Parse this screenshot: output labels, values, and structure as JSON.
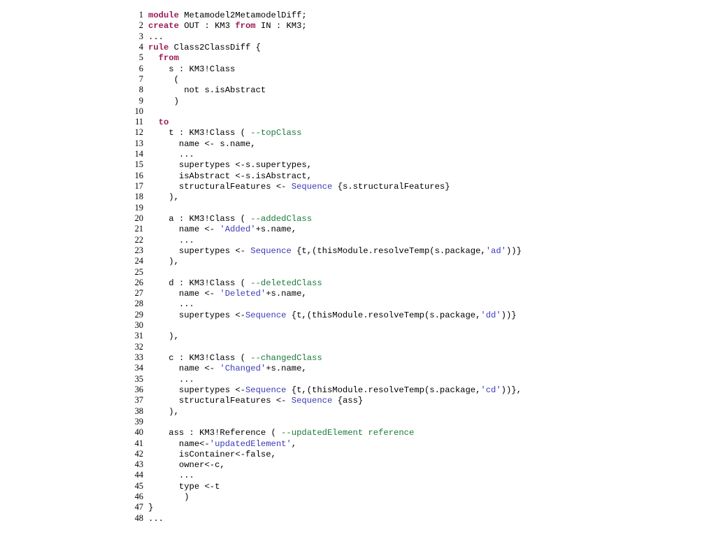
{
  "document": {
    "kind": "source-code-listing",
    "language": "ATL",
    "background_color": "#ffffff",
    "first_line_number": 1,
    "last_line_number": 48
  },
  "colors": {
    "keyword": "#9b1b56",
    "comment": "#1a7a3c",
    "string": "#3a3ab8",
    "type": "#3a3ab8",
    "plain": "#000000",
    "lineno": "#000000",
    "background": "#ffffff"
  },
  "lines": [
    {
      "n": "1",
      "tokens": [
        {
          "t": "kw",
          "v": "module"
        },
        {
          "t": "plain",
          "v": " Metamodel2MetamodelDiff;"
        }
      ]
    },
    {
      "n": "2",
      "tokens": [
        {
          "t": "kw",
          "v": "create"
        },
        {
          "t": "plain",
          "v": " OUT : KM3 "
        },
        {
          "t": "kw",
          "v": "from"
        },
        {
          "t": "plain",
          "v": " IN : KM3;"
        }
      ]
    },
    {
      "n": "3",
      "tokens": [
        {
          "t": "plain",
          "v": "..."
        }
      ]
    },
    {
      "n": "4",
      "tokens": [
        {
          "t": "kw",
          "v": "rule"
        },
        {
          "t": "plain",
          "v": " Class2ClassDiff {"
        }
      ]
    },
    {
      "n": "5",
      "tokens": [
        {
          "t": "plain",
          "v": "  "
        },
        {
          "t": "kw",
          "v": "from"
        }
      ]
    },
    {
      "n": "6",
      "tokens": [
        {
          "t": "plain",
          "v": "    s : KM3!Class"
        }
      ]
    },
    {
      "n": "7",
      "tokens": [
        {
          "t": "plain",
          "v": "     ("
        }
      ]
    },
    {
      "n": "8",
      "tokens": [
        {
          "t": "plain",
          "v": "       not s.isAbstract"
        }
      ]
    },
    {
      "n": "9",
      "tokens": [
        {
          "t": "plain",
          "v": "     )"
        }
      ]
    },
    {
      "n": "10",
      "tokens": [
        {
          "t": "plain",
          "v": ""
        }
      ]
    },
    {
      "n": "11",
      "tokens": [
        {
          "t": "plain",
          "v": "  "
        },
        {
          "t": "kw",
          "v": "to"
        }
      ]
    },
    {
      "n": "12",
      "tokens": [
        {
          "t": "plain",
          "v": "    t : KM3!Class ( "
        },
        {
          "t": "cm",
          "v": "--topClass"
        }
      ]
    },
    {
      "n": "13",
      "tokens": [
        {
          "t": "plain",
          "v": "      name <- s.name,"
        }
      ]
    },
    {
      "n": "14",
      "tokens": [
        {
          "t": "plain",
          "v": "      ..."
        }
      ]
    },
    {
      "n": "15",
      "tokens": [
        {
          "t": "plain",
          "v": "      supertypes <-s.supertypes,"
        }
      ]
    },
    {
      "n": "16",
      "tokens": [
        {
          "t": "plain",
          "v": "      isAbstract <-s.isAbstract,"
        }
      ]
    },
    {
      "n": "17",
      "tokens": [
        {
          "t": "plain",
          "v": "      structuralFeatures <- "
        },
        {
          "t": "type",
          "v": "Sequence"
        },
        {
          "t": "plain",
          "v": " {s.structuralFeatures}"
        }
      ]
    },
    {
      "n": "18",
      "tokens": [
        {
          "t": "plain",
          "v": "    ),"
        }
      ]
    },
    {
      "n": "19",
      "tokens": [
        {
          "t": "plain",
          "v": ""
        }
      ]
    },
    {
      "n": "20",
      "tokens": [
        {
          "t": "plain",
          "v": "    a : KM3!Class ( "
        },
        {
          "t": "cm",
          "v": "--addedClass"
        }
      ]
    },
    {
      "n": "21",
      "tokens": [
        {
          "t": "plain",
          "v": "      name <- "
        },
        {
          "t": "str",
          "v": "'Added'"
        },
        {
          "t": "plain",
          "v": "+s.name,"
        }
      ]
    },
    {
      "n": "22",
      "tokens": [
        {
          "t": "plain",
          "v": "      ..."
        }
      ]
    },
    {
      "n": "23",
      "tokens": [
        {
          "t": "plain",
          "v": "      supertypes <- "
        },
        {
          "t": "type",
          "v": "Sequence"
        },
        {
          "t": "plain",
          "v": " {t,(thisModule.resolveTemp(s.package,"
        },
        {
          "t": "str",
          "v": "'ad'"
        },
        {
          "t": "plain",
          "v": "))}"
        }
      ]
    },
    {
      "n": "24",
      "tokens": [
        {
          "t": "plain",
          "v": "    ),"
        }
      ]
    },
    {
      "n": "25",
      "tokens": [
        {
          "t": "plain",
          "v": ""
        }
      ]
    },
    {
      "n": "26",
      "tokens": [
        {
          "t": "plain",
          "v": "    d : KM3!Class ( "
        },
        {
          "t": "cm",
          "v": "--deletedClass"
        }
      ]
    },
    {
      "n": "27",
      "tokens": [
        {
          "t": "plain",
          "v": "      name <- "
        },
        {
          "t": "str",
          "v": "'Deleted'"
        },
        {
          "t": "plain",
          "v": "+s.name,"
        }
      ]
    },
    {
      "n": "28",
      "tokens": [
        {
          "t": "plain",
          "v": "      ..."
        }
      ]
    },
    {
      "n": "29",
      "tokens": [
        {
          "t": "plain",
          "v": "      supertypes <-"
        },
        {
          "t": "type",
          "v": "Sequence"
        },
        {
          "t": "plain",
          "v": " {t,(thisModule.resolveTemp(s.package,"
        },
        {
          "t": "str",
          "v": "'dd'"
        },
        {
          "t": "plain",
          "v": "))}"
        }
      ]
    },
    {
      "n": "30",
      "tokens": [
        {
          "t": "plain",
          "v": ""
        }
      ]
    },
    {
      "n": "31",
      "tokens": [
        {
          "t": "plain",
          "v": "    ),"
        }
      ]
    },
    {
      "n": "32",
      "tokens": [
        {
          "t": "plain",
          "v": ""
        }
      ]
    },
    {
      "n": "33",
      "tokens": [
        {
          "t": "plain",
          "v": "    c : KM3!Class ( "
        },
        {
          "t": "cm",
          "v": "--changedClass"
        }
      ]
    },
    {
      "n": "34",
      "tokens": [
        {
          "t": "plain",
          "v": "      name <- "
        },
        {
          "t": "str",
          "v": "'Changed'"
        },
        {
          "t": "plain",
          "v": "+s.name,"
        }
      ]
    },
    {
      "n": "35",
      "tokens": [
        {
          "t": "plain",
          "v": "      ..."
        }
      ]
    },
    {
      "n": "36",
      "tokens": [
        {
          "t": "plain",
          "v": "      supertypes <-"
        },
        {
          "t": "type",
          "v": "Sequence"
        },
        {
          "t": "plain",
          "v": " {t,(thisModule.resolveTemp(s.package,"
        },
        {
          "t": "str",
          "v": "'cd'"
        },
        {
          "t": "plain",
          "v": "))},"
        }
      ]
    },
    {
      "n": "37",
      "tokens": [
        {
          "t": "plain",
          "v": "      structuralFeatures <- "
        },
        {
          "t": "type",
          "v": "Sequence"
        },
        {
          "t": "plain",
          "v": " {ass}"
        }
      ]
    },
    {
      "n": "38",
      "tokens": [
        {
          "t": "plain",
          "v": "    ),"
        }
      ]
    },
    {
      "n": "39",
      "tokens": [
        {
          "t": "plain",
          "v": ""
        }
      ]
    },
    {
      "n": "40",
      "tokens": [
        {
          "t": "plain",
          "v": "    ass : KM3!Reference ( "
        },
        {
          "t": "cm",
          "v": "--updatedElement reference"
        }
      ]
    },
    {
      "n": "41",
      "tokens": [
        {
          "t": "plain",
          "v": "      name<-"
        },
        {
          "t": "str",
          "v": "'updatedElement'"
        },
        {
          "t": "plain",
          "v": ","
        }
      ]
    },
    {
      "n": "42",
      "tokens": [
        {
          "t": "plain",
          "v": "      isContainer<-false,"
        }
      ]
    },
    {
      "n": "43",
      "tokens": [
        {
          "t": "plain",
          "v": "      owner<-c,"
        }
      ]
    },
    {
      "n": "44",
      "tokens": [
        {
          "t": "plain",
          "v": "      ..."
        }
      ]
    },
    {
      "n": "45",
      "tokens": [
        {
          "t": "plain",
          "v": "      type <-t"
        }
      ]
    },
    {
      "n": "46",
      "tokens": [
        {
          "t": "plain",
          "v": "       )"
        }
      ]
    },
    {
      "n": "47",
      "tokens": [
        {
          "t": "plain",
          "v": "}"
        }
      ]
    },
    {
      "n": "48",
      "tokens": [
        {
          "t": "plain",
          "v": "..."
        }
      ]
    }
  ]
}
